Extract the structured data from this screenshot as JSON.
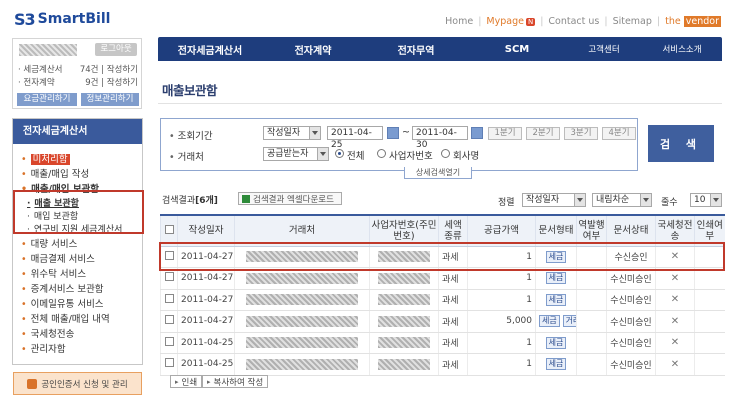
{
  "logo": {
    "mark": "S3",
    "brand": "SmartBill"
  },
  "toplinks": {
    "home": "Home",
    "mypage": "Mypage",
    "mypage_badge": "N",
    "contact": "Contact us",
    "sitemap": "Sitemap",
    "vendor_prefix": "the",
    "vendor": "vendor"
  },
  "user": {
    "logout": "로그아웃",
    "rows": [
      {
        "label": "· 세금계산서",
        "count": "74건 | 작성하기"
      },
      {
        "label": "· 전자계약",
        "count": "9건 | 작성하기"
      }
    ],
    "btn_fee": "요금관리하기",
    "btn_info": "정보관리하기"
  },
  "topnav": [
    "전자세금계산서",
    "전자계약",
    "전자무역",
    "SCM",
    "고객센터",
    "서비스소개"
  ],
  "page_title": "매출보관함",
  "sidebar": {
    "title": "전자세금계산서",
    "items": [
      "미처리함",
      "매출/매입 작성",
      "매출/매입 보관함",
      "대량 서비스",
      "매금결제 서비스",
      "위수탁 서비스",
      "증계서비스 보관함",
      "이메일유통 서비스",
      "전체 매출/매입 내역",
      "국세청전송",
      "관리자함"
    ],
    "subitems": [
      "매출 보관함",
      "매입 보관함",
      "연구비 지원 세금계산서"
    ]
  },
  "cert_button": "공인인증서 신청 및 관리",
  "search": {
    "period_label": "조회기간",
    "period_type": "작성일자",
    "date_from": "2011-04-25",
    "date_to": "2011-04-30",
    "date_sep": "~",
    "periods": [
      "1분기",
      "2분기",
      "3분기",
      "4분기"
    ],
    "partner_label": "거래처",
    "partner_type": "공급받는자",
    "radio_all": "전체",
    "radio_bizno": "사업자번호",
    "radio_company": "회사명",
    "detail_toggle": "상세검색열기",
    "submit": "검 색"
  },
  "results": {
    "label": "검색결과",
    "count": "[6개]",
    "excel": "검색결과 엑셀다운로드",
    "sort_label": "정렬",
    "sort_field": "작성일자",
    "sort_order": "내림차순",
    "page_size_label": "줄수",
    "page_size": "10"
  },
  "table": {
    "headers": [
      "작성일자",
      "거래처",
      "사업자번호(주민번호)",
      "세액종류",
      "공급가액",
      "문서형태",
      "역발행여부",
      "문서상태",
      "국세청전송",
      "인쇄여부"
    ],
    "rows": [
      {
        "date": "2011-04-27",
        "tax": "과세",
        "amount": "1",
        "tags": [
          "세금"
        ],
        "status": "수신승인",
        "nts": "✕"
      },
      {
        "date": "2011-04-27",
        "tax": "과세",
        "amount": "1",
        "tags": [
          "세금"
        ],
        "status": "수신미승인",
        "nts": "✕"
      },
      {
        "date": "2011-04-27",
        "tax": "과세",
        "amount": "1",
        "tags": [
          "세금"
        ],
        "status": "수신미승인",
        "nts": "✕"
      },
      {
        "date": "2011-04-27",
        "tax": "과세",
        "amount": "5,000",
        "tags": [
          "세금",
          "거래"
        ],
        "status": "수신미승인",
        "nts": "✕"
      },
      {
        "date": "2011-04-25",
        "tax": "과세",
        "amount": "1",
        "tags": [
          "세금"
        ],
        "status": "수신미승인",
        "nts": "✕"
      },
      {
        "date": "2011-04-25",
        "tax": "과세",
        "amount": "1",
        "tags": [
          "세금"
        ],
        "status": "수신미승인",
        "nts": "✕"
      }
    ]
  },
  "footer": {
    "print": "인쇄",
    "copy": "복사하여 작성"
  }
}
